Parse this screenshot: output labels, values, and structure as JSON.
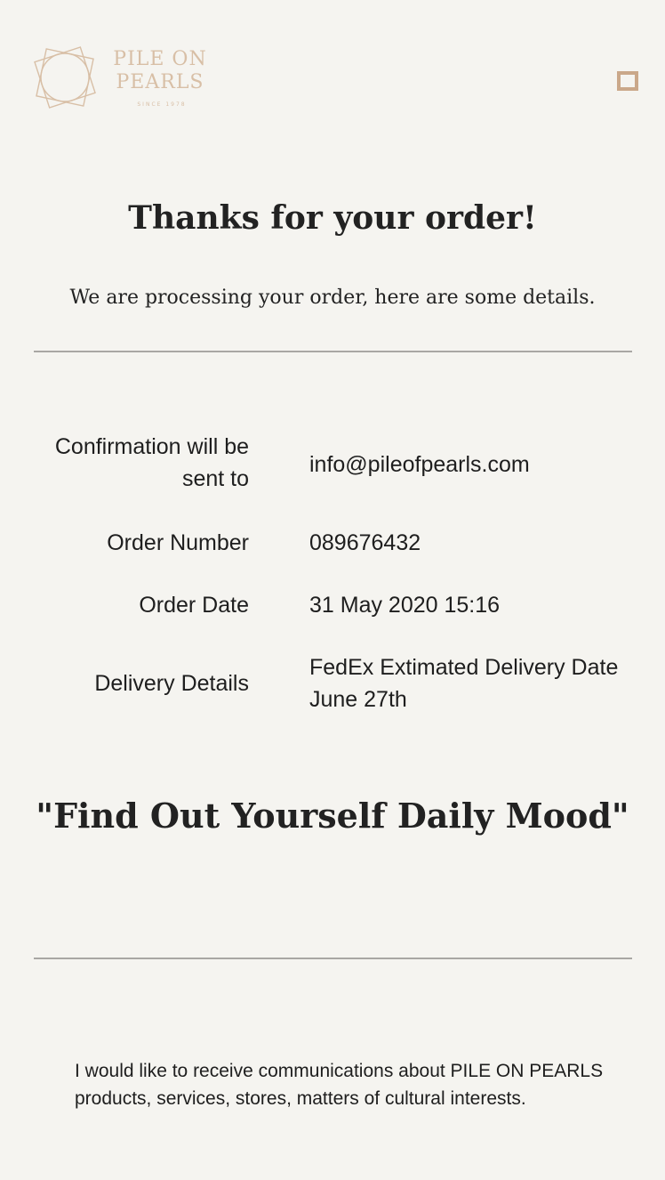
{
  "brand": {
    "name_line1": "PILE ON",
    "name_line2": "PEARLS",
    "tagline": "SINCE 1978",
    "accent_color": "#caa88a"
  },
  "header": {
    "menu_icon": "square-outline-icon"
  },
  "page": {
    "title": "Thanks for your order!",
    "subtitle": "We are processing your order, here are some details."
  },
  "details": [
    {
      "label": "Confirmation will be sent to",
      "value": "info@pileofpearls.com"
    },
    {
      "label": "Order Number",
      "value": "089676432"
    },
    {
      "label": "Order Date",
      "value": "31 May 2020 15:16"
    },
    {
      "label": "Delivery Details",
      "value": "FedEx Extimated Delivery Date June 27th"
    }
  ],
  "quote": "\"Find Out Yourself Daily Mood\"",
  "consent": {
    "text": "I would like to receive communications about PILE ON PEARLS products, services, stores, matters of cultural interests."
  }
}
